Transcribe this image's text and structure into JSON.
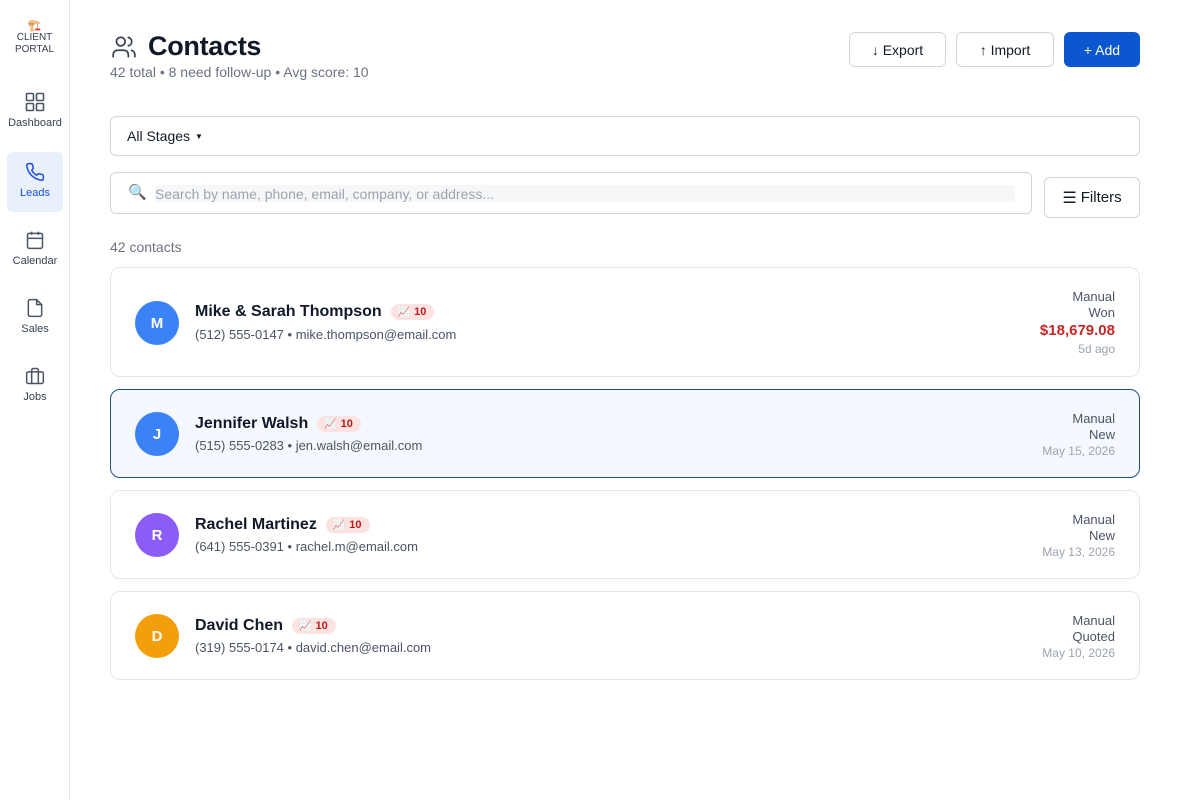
{
  "brand": {
    "logo": "🏗️",
    "line1": "CLIENT",
    "line2": "PORTAL"
  },
  "nav": [
    {
      "label": "Dashboard",
      "icon": "grid-icon",
      "active": false
    },
    {
      "label": "Leads",
      "icon": "phone-icon",
      "active": true
    },
    {
      "label": "Calendar",
      "icon": "calendar-icon",
      "active": false
    },
    {
      "label": "Sales",
      "icon": "file-icon",
      "active": false
    },
    {
      "label": "Jobs",
      "icon": "briefcase-icon",
      "active": false
    }
  ],
  "header": {
    "title": "Contacts",
    "subtitle": "42 total • 8 need follow-up • Avg score: 10",
    "export_label": "↓ Export",
    "import_label": "↑ Import",
    "add_label": "+ Add"
  },
  "filters": {
    "stage_value": "All Stages",
    "search_placeholder": "Search by name, phone, email, company, or address...",
    "filters_label": "Filters"
  },
  "count_label": "42 contacts",
  "contacts": [
    {
      "initial": "M",
      "avatar_color": "#3b82f6",
      "name": "Mike & Sarah Thompson",
      "score": "10",
      "phone": "(512) 555-0147",
      "email": "mike.thompson@email.com",
      "source": "Manual",
      "stage": "Won",
      "amount": "$18,679.08",
      "date": "5d ago"
    },
    {
      "initial": "J",
      "avatar_color": "#3b82f6",
      "name": "Jennifer Walsh",
      "score": "10",
      "phone": "(515) 555-0283",
      "email": "jen.walsh@email.com",
      "source": "Manual",
      "stage": "New",
      "date": "May 15, 2026"
    },
    {
      "initial": "R",
      "avatar_color": "#8b5cf6",
      "name": "Rachel Martinez",
      "score": "10",
      "phone": "(641) 555-0391",
      "email": "rachel.m@email.com",
      "source": "Manual",
      "stage": "New",
      "date": "May 13, 2026"
    },
    {
      "initial": "D",
      "avatar_color": "#f59e0b",
      "name": "David Chen",
      "score": "10",
      "phone": "(319) 555-0174",
      "email": "david.chen@email.com",
      "source": "Manual",
      "stage": "Quoted",
      "date": "May 10, 2026"
    }
  ],
  "colors": {
    "accent": "#0b57d0",
    "amount": "#c62828",
    "score_bg": "#fde2e2"
  }
}
